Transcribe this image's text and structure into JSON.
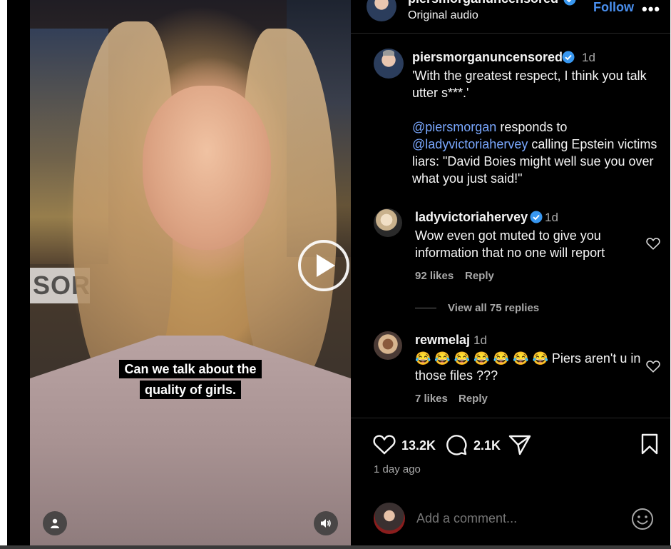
{
  "post": {
    "author": "piersmorganuncensored",
    "audio": "Original audio",
    "follow_label": "Follow",
    "more_label": "•••"
  },
  "video": {
    "caption_line1": "Can we talk about the",
    "caption_line2": "quality of girls.",
    "logo_text": "SOR"
  },
  "description": {
    "author": "piersmorganuncensored",
    "time": "1d",
    "quote": "'With the greatest respect, I think you talk utter s***.'",
    "mention1": "@piersmorgan",
    "text1": " responds to",
    "mention2": "@ladyvictoriahervey",
    "text2": " calling Epstein victims liars: \"David Boies might well sue you over what you just said!\""
  },
  "comments": [
    {
      "user": "ladyvictoriahervey",
      "time": "1d",
      "text": "Wow even got muted to give you information that no one will report",
      "likes": "92 likes",
      "reply_label": "Reply",
      "view_replies": "View all 75 replies"
    },
    {
      "user": "rewmelaj",
      "time": "1d",
      "text": "😂 😂 😂 😂 😂 😂 😂  Piers aren't u in those files ???",
      "likes": "7 likes",
      "reply_label": "Reply"
    }
  ],
  "actions": {
    "like_count": "13.2K",
    "comment_count": "2.1K",
    "posted": "1 day ago"
  },
  "composer": {
    "placeholder": "Add a comment..."
  },
  "colors": {
    "background": "#000000",
    "link": "#7aa8ff",
    "follow": "#4a90f0",
    "muted": "#a8a8a8",
    "verified": "#3897f0"
  }
}
